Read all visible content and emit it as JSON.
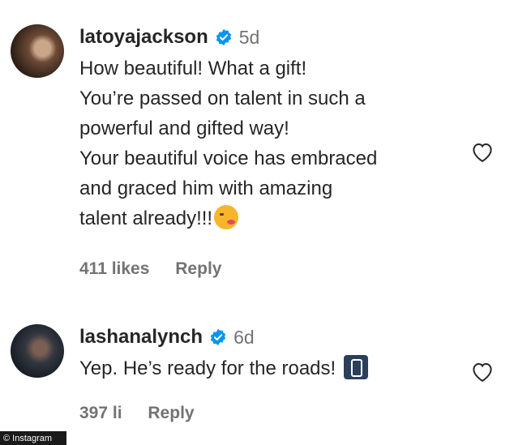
{
  "comments": [
    {
      "username": "latoyajackson",
      "time": "5d",
      "lines": [
        "How beautiful! What a gift!",
        "You’re passed on talent in such a",
        "powerful and gifted way!",
        "Your beautiful voice has embraced",
        "and graced him with amazing",
        "talent already!!!"
      ],
      "likes": "411 likes",
      "reply": "Reply",
      "emoji": "winking-face-with-kiss-icon"
    },
    {
      "username": "lashanalynch",
      "time": "6d",
      "lines": [
        "Yep. He’s ready for the roads!"
      ],
      "likes": "397 li",
      "reply": "Reply",
      "emoji": "vertical-traffic-light-icon"
    }
  ],
  "watermark": "© Instagram",
  "colors": {
    "text": "#262626",
    "muted": "#737373",
    "verified": "#0095f6"
  }
}
